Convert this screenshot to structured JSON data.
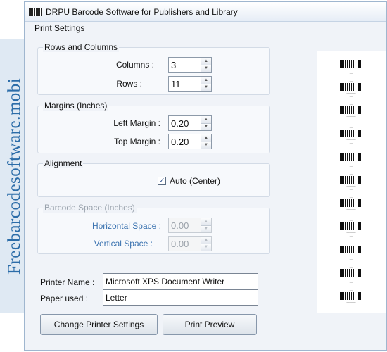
{
  "watermark": "Freebarcodesoftware.mobi",
  "window": {
    "title": "DRPU Barcode Software for Publishers and Library",
    "icon": "barcode-icon"
  },
  "panel": {
    "title": "Print Settings"
  },
  "rows_columns": {
    "title": "Rows and Columns",
    "columns_label": "Columns :",
    "columns_value": "3",
    "rows_label": "Rows :",
    "rows_value": "11"
  },
  "margins": {
    "title": "Margins (Inches)",
    "left_label": "Left Margin :",
    "left_value": "0.20",
    "top_label": "Top Margin :",
    "top_value": "0.20"
  },
  "alignment": {
    "title": "Alignment",
    "auto_label": "Auto (Center)",
    "auto_checked": true
  },
  "barcode_space": {
    "title": "Barcode Space (Inches)",
    "horizontal_label": "Horizontal Space :",
    "horizontal_value": "0.00",
    "vertical_label": "Vertical Space :",
    "vertical_value": "0.00",
    "enabled": false
  },
  "printer": {
    "name_label": "Printer Name :",
    "name_value": "Microsoft XPS Document Writer",
    "paper_label": "Paper used :",
    "paper_value": "Letter"
  },
  "buttons": {
    "change_printer": "Change Printer Settings",
    "print_preview": "Print Preview"
  },
  "preview": {
    "label_count": 11
  },
  "colors": {
    "watermark_text": "#2b6ca8",
    "disabled_label": "#3b73b0",
    "window_border": "#9fb6cf"
  }
}
